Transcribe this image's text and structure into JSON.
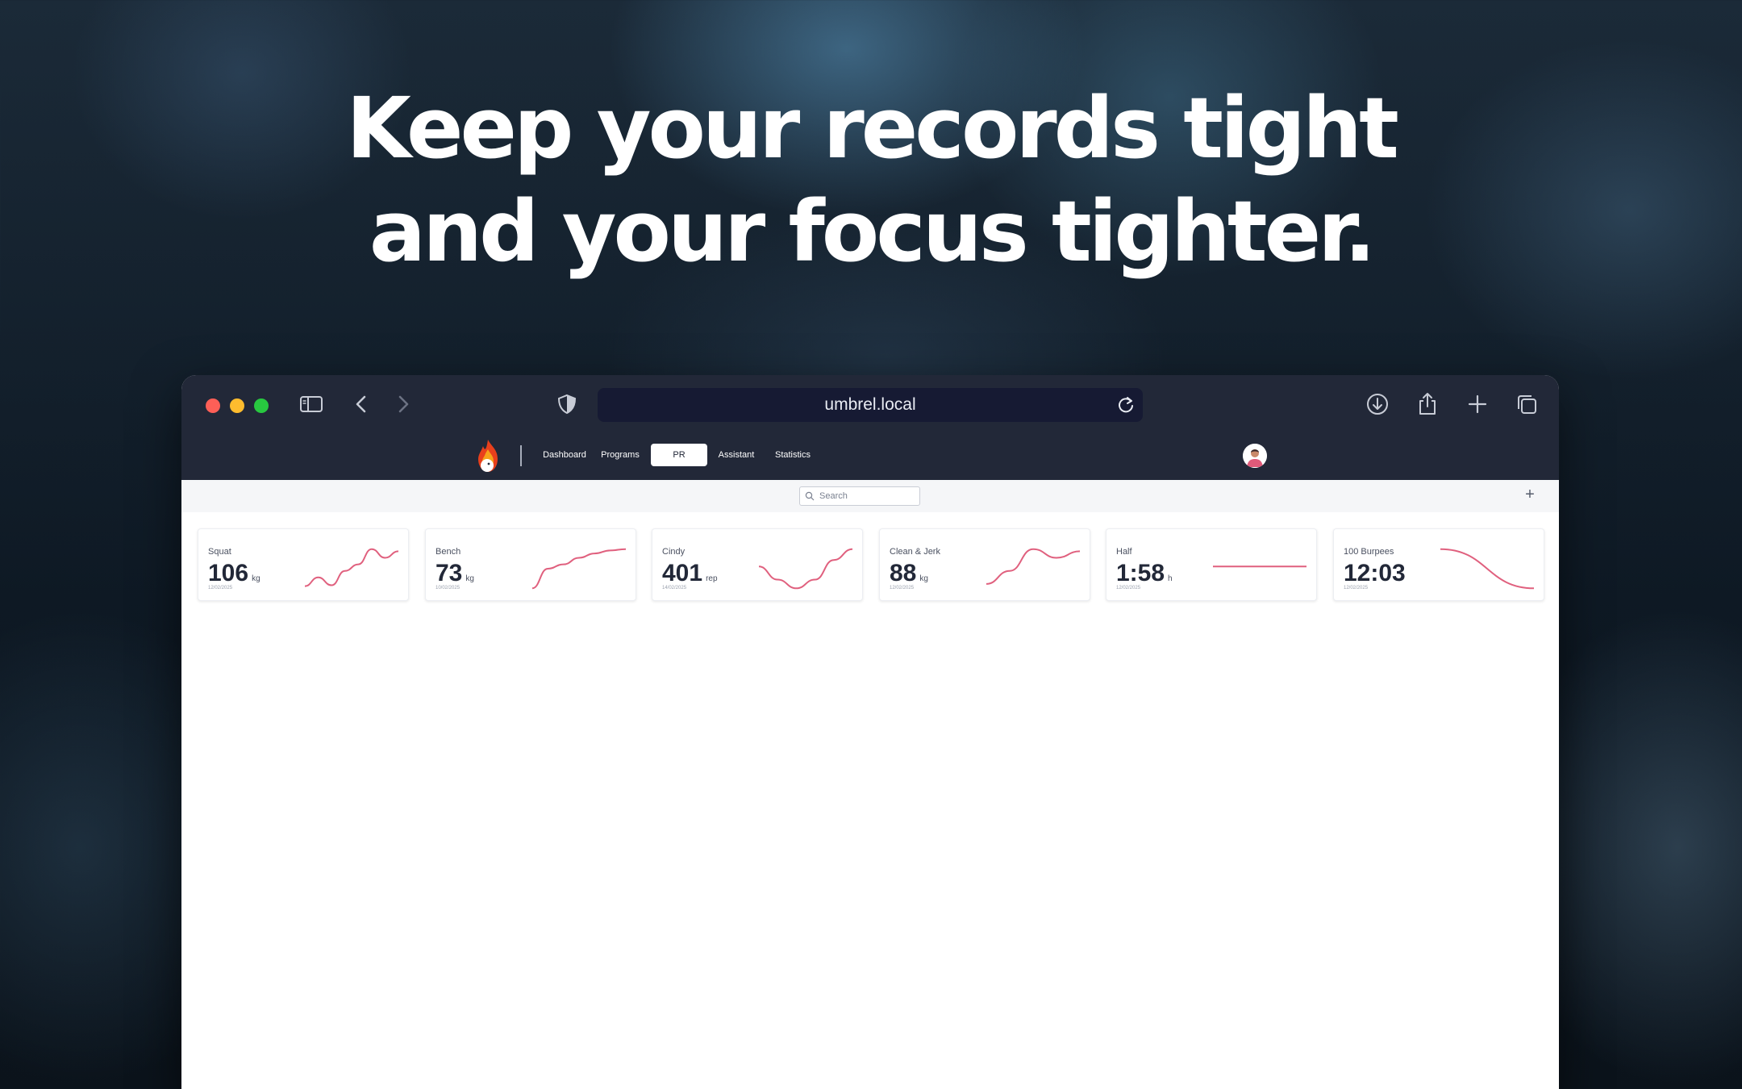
{
  "headline": {
    "line1": "Keep your records tight",
    "line2": "and your focus tighter."
  },
  "browser": {
    "url": "umbrel.local",
    "traffic_lights": [
      "close",
      "minimize",
      "zoom"
    ],
    "toolbar_icons": [
      "sidebar-icon",
      "back-icon",
      "forward-icon",
      "shield-icon",
      "reload-icon",
      "download-icon",
      "share-icon",
      "new-tab-icon",
      "tabs-overview-icon"
    ]
  },
  "app": {
    "nav": [
      {
        "label": "Dashboard",
        "active": false
      },
      {
        "label": "Programs",
        "active": false
      },
      {
        "label": "PR",
        "active": true
      },
      {
        "label": "Assistant",
        "active": false
      },
      {
        "label": "Statistics",
        "active": false
      }
    ],
    "search": {
      "placeholder": "Search"
    },
    "add_label": "+"
  },
  "cards": [
    {
      "name": "Squat",
      "value": "106",
      "unit": "kg",
      "date": "12/02/2025",
      "trend": [
        0.1,
        0.3,
        0.12,
        0.45,
        0.6,
        0.95,
        0.75,
        0.9
      ]
    },
    {
      "name": "Bench",
      "value": "73",
      "unit": "kg",
      "date": "10/02/2025",
      "trend": [
        0.05,
        0.5,
        0.6,
        0.75,
        0.85,
        0.92,
        0.95
      ]
    },
    {
      "name": "Cindy",
      "value": "401",
      "unit": "rep",
      "date": "14/02/2025",
      "trend": [
        0.55,
        0.25,
        0.05,
        0.25,
        0.7,
        0.95
      ]
    },
    {
      "name": "Clean & Jerk",
      "value": "88",
      "unit": "kg",
      "date": "12/02/2025",
      "trend": [
        0.15,
        0.45,
        0.95,
        0.75,
        0.9
      ]
    },
    {
      "name": "Half",
      "value": "1:58",
      "unit": "h",
      "date": "12/02/2025",
      "trend": [
        0.55,
        0.55,
        0.55,
        0.55
      ]
    },
    {
      "name": "100 Burpees",
      "value": "12:03",
      "unit": "",
      "date": "12/02/2025",
      "trend": [
        0.95,
        0.05
      ]
    }
  ],
  "colors": {
    "chrome": "#222838",
    "accent_line": "#e0607e",
    "text_dark": "#222838"
  }
}
